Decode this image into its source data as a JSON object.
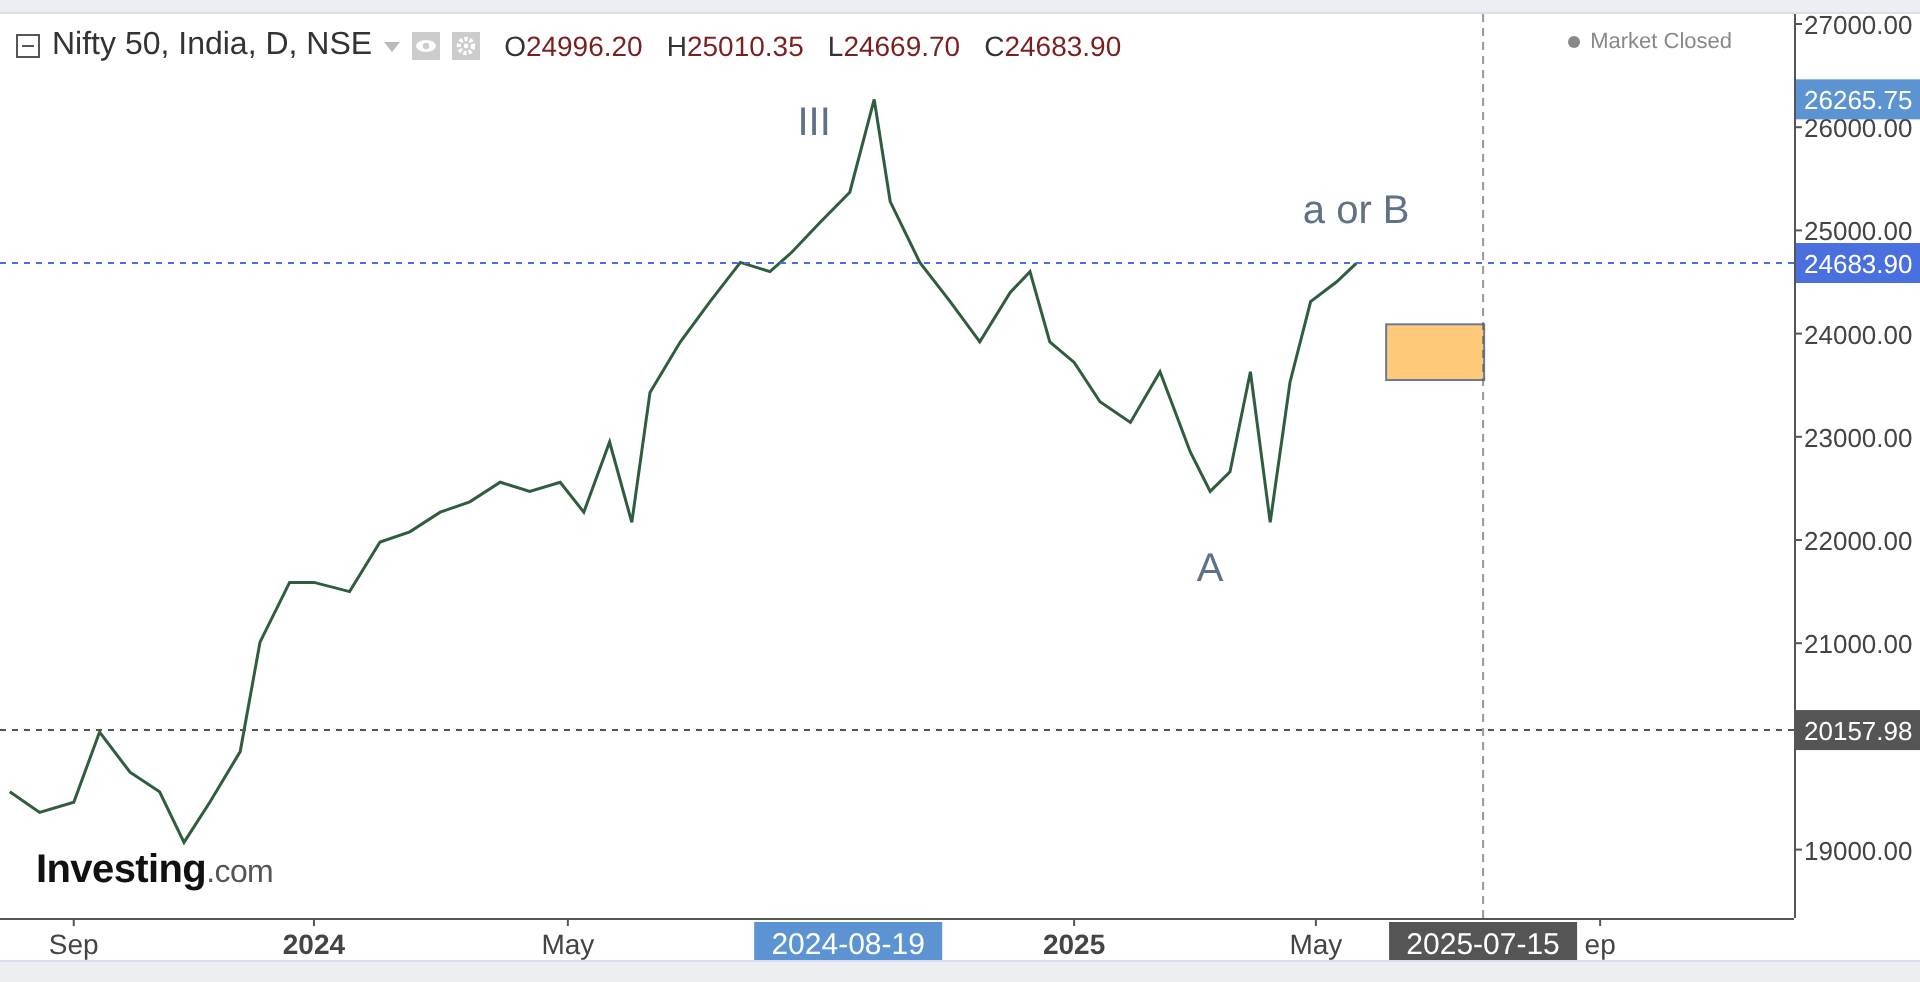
{
  "legend": {
    "symbol": "Nifty 50, India, D, NSE",
    "ohlc": [
      {
        "label": "O",
        "value": "24996.20"
      },
      {
        "label": "H",
        "value": "25010.35"
      },
      {
        "label": "L",
        "value": "24669.70"
      },
      {
        "label": "C",
        "value": "24683.90"
      }
    ]
  },
  "market_status": {
    "text": "Market Closed"
  },
  "high_marker": {
    "text": "26265.75"
  },
  "cursor": {
    "text": "2024-08-19"
  },
  "date_marker": {
    "text": "2025-07-15"
  },
  "logo": {
    "text": "**Investing**.com"
  },
  "chart_data": {
    "type": "line",
    "xlim": [
      2023.587,
      2025.947
    ],
    "ylim": [
      18337,
      27097
    ],
    "yticks": [
      {
        "value": 19000,
        "label": "19000.00"
      },
      {
        "value": 21000,
        "label": "21000.00"
      },
      {
        "value": 22000,
        "label": "22000.00"
      },
      {
        "value": 23000,
        "label": "23000.00"
      },
      {
        "value": 24000,
        "label": "24000.00"
      },
      {
        "value": 25000,
        "label": "25000.00"
      },
      {
        "value": 26000,
        "label": "26000.00"
      },
      {
        "value": 27000,
        "label": "27000.00"
      }
    ],
    "xticks": [
      {
        "value": 2023.684,
        "label": "Sep"
      },
      {
        "value": 2024,
        "label": "2024"
      },
      {
        "value": 2024.334,
        "label": "May"
      },
      {
        "value": 2025,
        "label": "2025"
      },
      {
        "value": 2025.318,
        "label": "May"
      },
      {
        "value": 2025.692,
        "label": "ep"
      }
    ],
    "x": [
      2023.6,
      2023.639,
      2023.684,
      2023.718,
      2023.758,
      2023.797,
      2023.829,
      2023.863,
      2023.903,
      2023.929,
      2023.968,
      2024.0,
      2024.047,
      2024.087,
      2024.126,
      2024.166,
      2024.205,
      2024.245,
      2024.284,
      2024.324,
      2024.355,
      2024.389,
      2024.418,
      2024.442,
      2024.482,
      2024.521,
      2024.561,
      2024.6,
      2024.629,
      2024.666,
      2024.705,
      2024.737,
      2024.758,
      2024.797,
      2024.837,
      2024.876,
      2024.916,
      2024.942,
      2024.968,
      2025.0,
      2025.034,
      2025.074,
      2025.113,
      2025.153,
      2025.179,
      2025.205,
      2025.232,
      2025.258,
      2025.284,
      2025.311,
      2025.345,
      2025.371
    ],
    "series": [
      {
        "color": "#2e5e3e",
        "values": [
          19560,
          19360,
          19460,
          20140,
          19750,
          19560,
          19070,
          19460,
          19950,
          21010,
          21590,
          21590,
          21500,
          21980,
          22080,
          22270,
          22370,
          22560,
          22470,
          22560,
          22270,
          22950,
          22170,
          23430,
          23920,
          24310,
          24690,
          24600,
          24790,
          25080,
          25370,
          26270,
          25280,
          24690,
          24310,
          23920,
          24400,
          24600,
          23920,
          23720,
          23340,
          23140,
          23630,
          22850,
          22470,
          22660,
          23630,
          22170,
          23530,
          24310,
          24500,
          24680
        ]
      }
    ],
    "annotations": [
      {
        "text": "III",
        "x": 2024.737,
        "y": 26270
      },
      {
        "text": "a or B",
        "x": 2025.371,
        "y": 24680
      },
      {
        "text": "A",
        "x": 2025.179,
        "y": 22470
      }
    ],
    "ref_lines": [
      {
        "axis": "y",
        "value": 24683.9,
        "label": "24683.90",
        "color": "#4a70e0"
      },
      {
        "axis": "y",
        "value": 20157.98,
        "label": "20157.98",
        "color": "#555555"
      },
      {
        "axis": "x",
        "value": 2025.538,
        "color": "#555555"
      }
    ],
    "bands": [
      {
        "axis": "y",
        "from": 23550,
        "to": 24090,
        "color": "#ffc97a"
      }
    ]
  }
}
